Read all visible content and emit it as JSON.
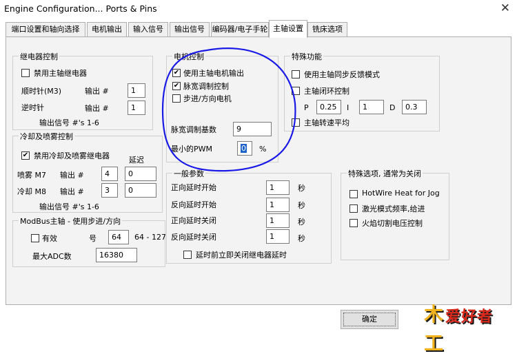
{
  "window": {
    "title": "Engine Configuration... Ports & Pins",
    "close_glyph": "✕"
  },
  "tabs": [
    {
      "label": "端口设置和轴向选择",
      "active": false
    },
    {
      "label": "电机输出",
      "active": false
    },
    {
      "label": "输入信号",
      "active": false
    },
    {
      "label": "输出信号",
      "active": false
    },
    {
      "label": "编码器/电子手轮",
      "active": false
    },
    {
      "label": "主轴设置",
      "active": true
    },
    {
      "label": "铣床选项",
      "active": false
    }
  ],
  "relay": {
    "title": "继电器控制",
    "disable_label": "禁用主轴继电器",
    "disable_checked": false,
    "cw_label": "顺时针(M3)",
    "ccw_label": "逆时针",
    "output_label": "输出 #",
    "cw_value": "1",
    "ccw_value": "1",
    "note": "输出信号 #'s 1-6"
  },
  "coolant": {
    "title": "冷却及喷雾控制",
    "disable_label": "禁用冷却及喷雾继电器",
    "disable_checked": true,
    "delay_label": "延迟",
    "mist_label": "喷雾 M7",
    "flood_label": "冷却 M8",
    "output_label": "输出 #",
    "mist_output": "4",
    "flood_output": "3",
    "mist_delay": "0",
    "flood_delay": "0",
    "note": "输出信号 #'s 1-6"
  },
  "modbus": {
    "title": "ModBus主轴 - 使用步进/方向",
    "enabled_label": "有效",
    "enabled_checked": false,
    "number_label": "号",
    "number_value": "64",
    "range_label": "64 - 127",
    "max_adc_label": "最大ADC数",
    "max_adc_value": "16380"
  },
  "motor": {
    "title": "电机控制",
    "use_spindle_label": "使用主轴电机输出",
    "use_spindle_checked": true,
    "pwm_label": "脉宽调制控制",
    "pwm_checked": true,
    "stepdir_label": "步进/方向电机",
    "stepdir_checked": false,
    "pwm_base_label": "脉宽调制基数",
    "pwm_base_value": "9",
    "min_pwm_label": "最小的PWM",
    "min_pwm_value": "0",
    "percent_unit": "%"
  },
  "special": {
    "title": "特殊功能",
    "sync_label": "使用主轴同步反馈模式",
    "sync_checked": false,
    "closed_loop_label": "主轴闭环控制",
    "closed_loop_checked": false,
    "p_label": "P",
    "p_value": "0.25",
    "i_label": "I",
    "i_value": "1",
    "d_label": "D",
    "d_value": "0.3",
    "avg_label": "主轴转速平均",
    "avg_checked": false
  },
  "general": {
    "title": "一般参数",
    "rows": [
      {
        "label": "正向延时开始",
        "value": "1",
        "unit": "秒"
      },
      {
        "label": "反向延时开始",
        "value": "1",
        "unit": "秒"
      },
      {
        "label": "正向延时关闭",
        "value": "1",
        "unit": "秒"
      },
      {
        "label": "反向延时关闭",
        "value": "1",
        "unit": "秒"
      }
    ],
    "immediate_label": "延时前立即关闭继电器延时",
    "immediate_checked": false
  },
  "special_options": {
    "title": "特殊选项, 通常为关闭",
    "items": [
      {
        "label": "HotWire Heat for Jog",
        "checked": false
      },
      {
        "label": "激光模式频率,给进",
        "checked": false
      },
      {
        "label": "火焰切割电压控制",
        "checked": false
      }
    ]
  },
  "footer": {
    "ok_label": "确定"
  },
  "watermark": {
    "text": "爱好者",
    "badge": "木工"
  },
  "colors": {
    "annotation_ellipse": "#1a1ae6",
    "selection": "#1e64c8"
  }
}
